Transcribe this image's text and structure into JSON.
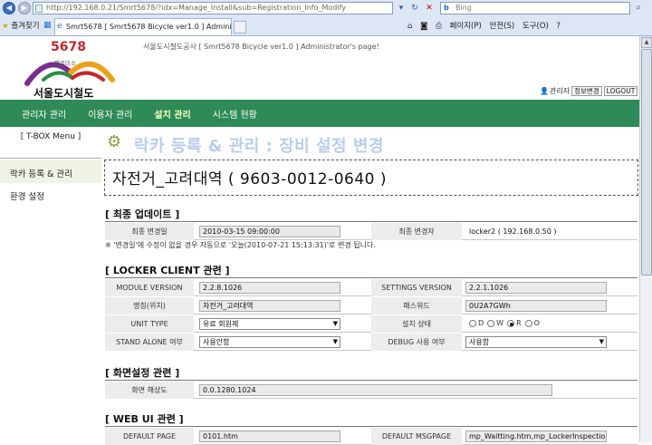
{
  "browser": {
    "url": "http://192.168.0.21/Smrt5678/?idx=Manage_Install&sub=Registration_Info_Modify",
    "search_placeholder": "Bing",
    "favorites": "즐겨찾기",
    "tab_title": "Smrt5678 [ Smrt5678 Bicycle ver1.0 ] Adminis...",
    "menu_page": "페이지(P)",
    "menu_safety": "안전(S)",
    "menu_tools": "도구(O)",
    "menu_help": "?"
  },
  "header": {
    "logo_number": "5678",
    "logo_sub": "행복미소",
    "logo_name": "서울도시철도",
    "admin_message": "서울도시철도공사 [ Smrt5678 Bicycle ver1.0 ] Administrator's page!",
    "admin_label": "관리자",
    "info_change": "정보변경",
    "logout": "LOGOUT"
  },
  "nav": {
    "items": [
      {
        "label": "관리자 관리"
      },
      {
        "label": "이용자 관리"
      },
      {
        "label": "설치 관리"
      },
      {
        "label": "시스템 현황"
      }
    ]
  },
  "sidebar": {
    "menu_title": "[ T-BOX Menu ]",
    "items": [
      {
        "label": "락카 등록 & 관리"
      },
      {
        "label": "환경 설정"
      }
    ]
  },
  "content": {
    "heading": "락카 등록 & 관리 : 장비 설정 변경",
    "device_name": "자전거_고려대역 ( 9603-0012-0640 )",
    "update": {
      "title": "[ 최종 업데이트 ]",
      "changed_date_label": "최종 변경일",
      "changed_date_value": "2010-03-15 09:00:00",
      "changer_label": "최종 변경자",
      "changer_value": "locker2 ( 192.168.0.50 )",
      "note": "※ '변경일'에 수정이 없을 경우 자동으로 '오늘(2010-07-21 15:13:31)'로 변경 됩니다."
    },
    "locker": {
      "title": "[ LOCKER CLIENT 관련 ]",
      "module_version_label": "MODULE VERSION",
      "module_version_value": "2.2.8.1026",
      "settings_version_label": "SETTINGS VERSION",
      "settings_version_value": "2.2.1.1026",
      "name_label": "명칭(위치)",
      "name_value": "자전거_고려대역",
      "password_label": "패스워드",
      "password_value": "0U2A7GWh",
      "unit_type_label": "UNIT TYPE",
      "unit_type_value": "유료 회원제",
      "install_state_label": "설치 상태",
      "install_options": [
        "D",
        "W",
        "R",
        "O"
      ],
      "install_selected": "R",
      "standalone_label": "STAND ALONE 여부",
      "standalone_value": "사용안함",
      "debug_label": "DEBUG 사용 여부",
      "debug_value": "사용함"
    },
    "screen": {
      "title": "[ 화면설정 관련 ]",
      "resolution_label": "화면 해상도",
      "resolution_value": "0.0.1280.1024"
    },
    "webui": {
      "title": "[ WEB UI 관련 ]",
      "default_page_label": "DEFAULT PAGE",
      "default_page_value": "0101.htm",
      "default_msgpage_label": "DEFAULT MSGPAGE",
      "default_msgpage_value": "mp_Waitting.htm,mp_LockerInspectio"
    }
  }
}
